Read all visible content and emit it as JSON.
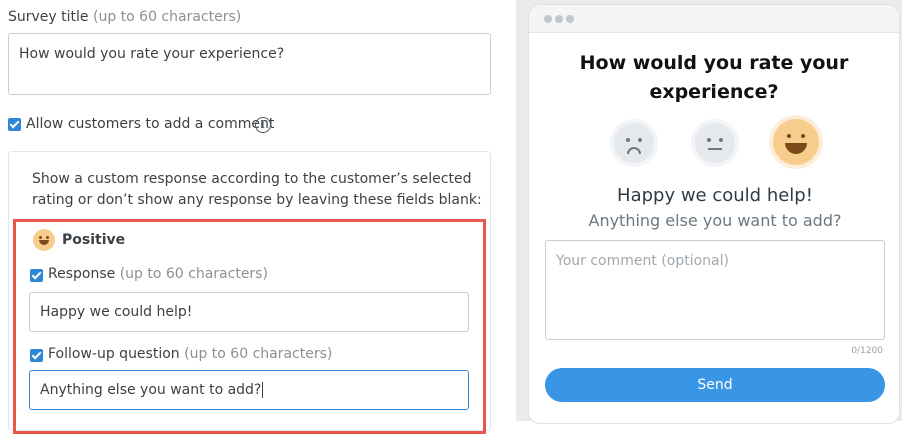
{
  "editor": {
    "survey_title_label": "Survey title",
    "survey_title_hint": "(up to 60 characters)",
    "survey_title_value": "How would you rate your experience?",
    "allow_comment_label": "Allow customers to add a comment",
    "allow_comment_checked": true,
    "info_icon_glyph": "i",
    "rules_description": "Show a custom response according to the customer’s selected rating or don’t show any response by leaving these fields blank:",
    "positive": {
      "label": "Positive",
      "response_label": "Response",
      "response_hint": "(up to 60 characters)",
      "response_checked": true,
      "response_value": "Happy we could help!",
      "followup_label": "Follow-up question",
      "followup_hint": "(up to 60 characters)",
      "followup_checked": true,
      "followup_value": "Anything else you want to add?"
    }
  },
  "preview": {
    "question": "How would you rate your experience?",
    "ratings": [
      "sad-face-icon",
      "neutral-face-icon",
      "happy-face-icon"
    ],
    "selected_rating": "happy-face-icon",
    "response": "Happy we could help!",
    "followup": "Anything else you want to add?",
    "comment_placeholder": "Your comment (optional)",
    "counter": "0/1200",
    "send_label": "Send"
  },
  "colors": {
    "accent": "#2d86d6",
    "send_button": "#3995e6",
    "highlight_border": "#e8584a",
    "happy_face": "#f8cc8c"
  }
}
